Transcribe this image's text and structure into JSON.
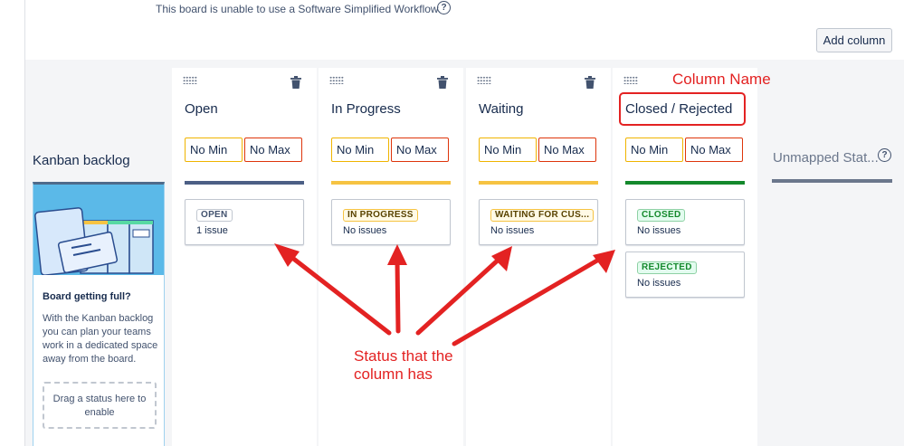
{
  "info": {
    "text": "This board is unable to use a Software Simplified Workflow.",
    "help_icon": "question-circle-icon"
  },
  "toolbar": {
    "add_column_label": "Add column"
  },
  "backlog": {
    "title": "Kanban backlog",
    "card_title": "Board getting full?",
    "card_text": "With the Kanban backlog you can plan your teams work in a dedicated space away from the board.",
    "drop_text": "Drag a status here to enable"
  },
  "columns": [
    {
      "name": "Open",
      "min_placeholder": "No Min",
      "max_placeholder": "No Max",
      "bar_color": "#4c5f85",
      "statuses": [
        {
          "label": "OPEN",
          "count": "1 issue",
          "tone": "#42526e",
          "bg": "#ffffff"
        }
      ]
    },
    {
      "name": "In Progress",
      "min_placeholder": "No Min",
      "max_placeholder": "No Max",
      "bar_color": "#f6c342",
      "statuses": [
        {
          "label": "IN PROGRESS",
          "count": "No issues",
          "tone": "#594300",
          "bg": "#fffae6"
        }
      ]
    },
    {
      "name": "Waiting",
      "min_placeholder": "No Min",
      "max_placeholder": "No Max",
      "bar_color": "#f6c342",
      "statuses": [
        {
          "label": "WAITING FOR CUS...",
          "count": "No issues",
          "tone": "#594300",
          "bg": "#fffae6"
        }
      ]
    },
    {
      "name": "Closed / Rejected",
      "min_placeholder": "No Min",
      "max_placeholder": "No Max",
      "bar_color": "#14892c",
      "statuses": [
        {
          "label": "CLOSED",
          "count": "No issues",
          "tone": "#14892c",
          "bg": "#e3fcef"
        },
        {
          "label": "REJECTED",
          "count": "No issues",
          "tone": "#14892c",
          "bg": "#e3fcef"
        }
      ]
    }
  ],
  "unmapped": {
    "title": "Unmapped Stat...",
    "help_icon": "question-circle-icon"
  },
  "annotations": {
    "column_name": "Column Name",
    "status_line1": "Status that the",
    "status_line2": "column has",
    "color": "#e32222"
  }
}
